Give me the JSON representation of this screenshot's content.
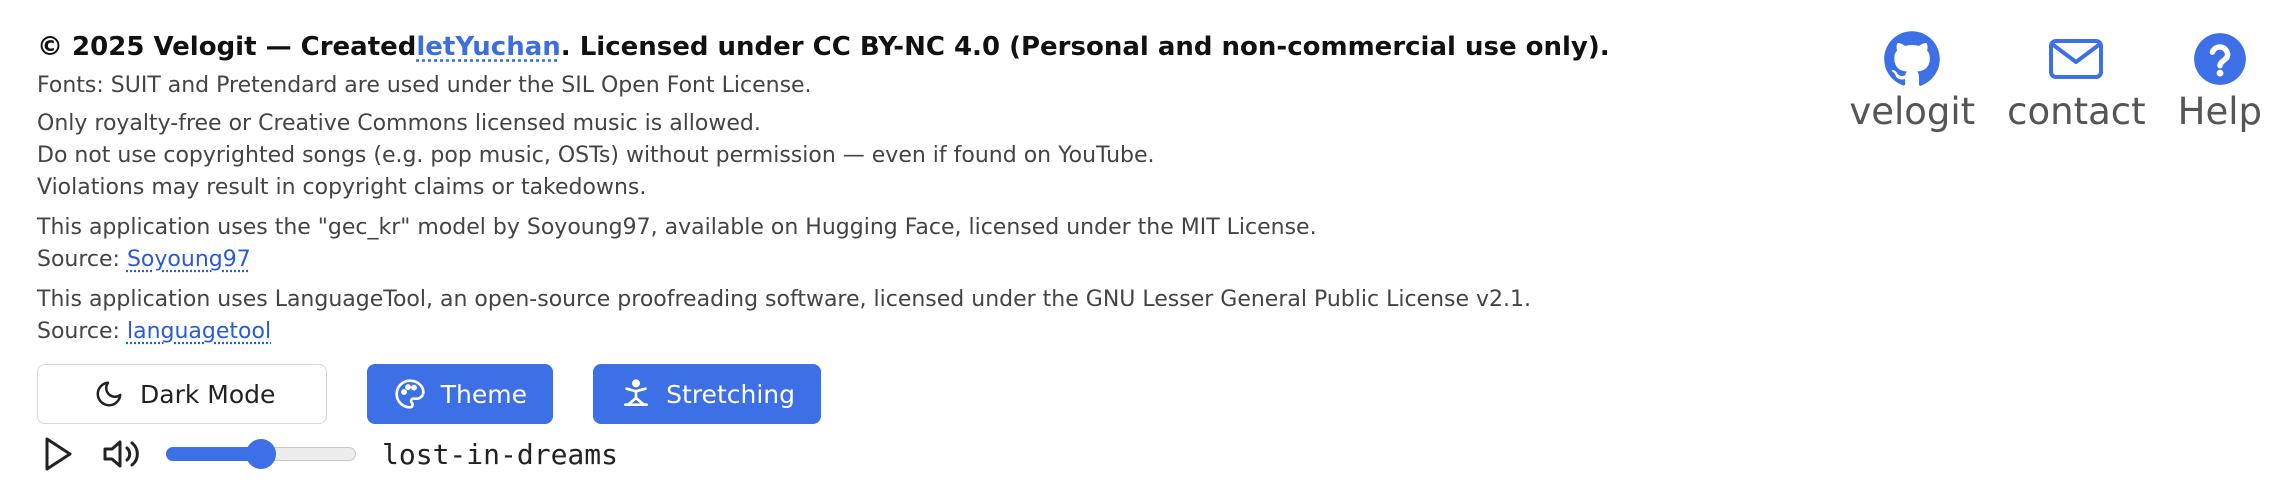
{
  "footer": {
    "copyright_prefix": "© 2025 Velogit — Created",
    "copyright_link": "letYuchan",
    "copyright_suffix": ". Licensed under CC BY-NC 4.0 (Personal and non-commercial use only).",
    "fonts_notice": "Fonts: SUIT and Pretendard are used under the SIL Open Font License.",
    "music_notice": [
      "Only royalty-free or Creative Commons licensed music is allowed.",
      "Do not use copyrighted songs (e.g. pop music, OSTs) without permission — even if found on YouTube.",
      "Violations may result in copyright claims or takedowns."
    ],
    "model_notice": "This application uses the \"gec_kr\" model by Soyoung97, available on Hugging Face, licensed under the MIT License.",
    "model_source_label": "Source: ",
    "model_source_link": "Soyoung97",
    "languagetool_notice": "This application uses LanguageTool, an open-source proofreading software, licensed under the GNU Lesser General Public License v2.1.",
    "languagetool_source_label": "Source: ",
    "languagetool_source_link": "languagetool"
  },
  "buttons": {
    "dark_mode": {
      "label": "Dark Mode",
      "icon": "moon-icon"
    },
    "theme": {
      "label": "Theme",
      "icon": "palette-icon"
    },
    "stretching": {
      "label": "Stretching",
      "icon": "stretching-figure-icon"
    }
  },
  "player": {
    "play_icon": "play-icon",
    "volume_icon": "volume-icon",
    "volume_level": 0.5,
    "track_name": "lost-in-dreams"
  },
  "links": [
    {
      "label": "velogit",
      "icon": "github-icon"
    },
    {
      "label": "contact",
      "icon": "mail-icon"
    },
    {
      "label": "Help",
      "icon": "help-icon"
    }
  ],
  "colors": {
    "accent": "#3d6fe6",
    "link": "#3b6fe0",
    "text_primary": "#111111",
    "text_secondary": "#444444",
    "link_label": "#555555"
  }
}
